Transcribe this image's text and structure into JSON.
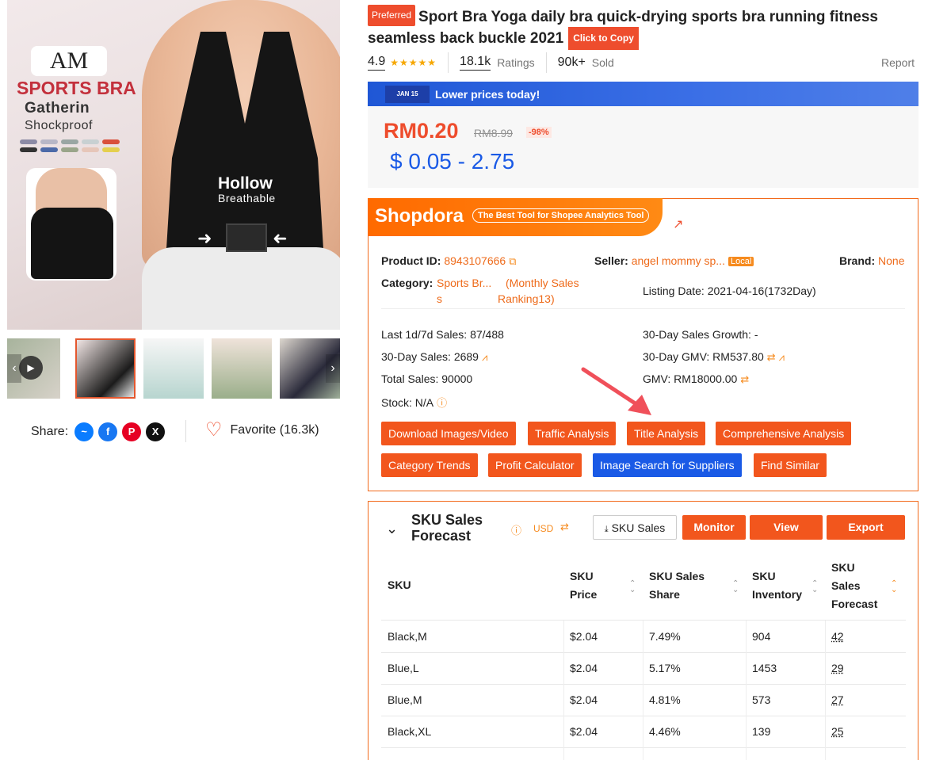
{
  "product": {
    "badge": "Preferred",
    "title": "Sport Bra Yoga daily bra quick-drying sports bra running fitness seamless back buckle 2021",
    "copy_button": "Click to Copy",
    "rating": "4.9",
    "stars": "★★★★★",
    "ratings_count": "18.1k",
    "ratings_label": "Ratings",
    "sold_count": "90k+",
    "sold_label": "Sold",
    "report": "Report"
  },
  "image": {
    "brand": "AM",
    "headline": "SPORTS BRA",
    "line1": "Gatherin",
    "line2": "Shockproof",
    "callout1": "Hollow",
    "callout2": "Breathable",
    "swatch_colors": [
      "#8c8ba5",
      "#b7b7c7",
      "#9aa6a3",
      "#c8d0d2",
      "#d9503c",
      "#333333",
      "#4c6aa8",
      "#9aa58a",
      "#e6c6b9",
      "#e4cf4e"
    ]
  },
  "promo": {
    "tag": "JAN 15",
    "text": "Lower prices today!"
  },
  "price": {
    "current": "RM0.20",
    "original": "RM8.99",
    "discount": "-98%",
    "usd_range": "$ 0.05 - 2.75"
  },
  "share": {
    "label": "Share:",
    "favorite": "Favorite (16.3k)"
  },
  "shopdora": {
    "logo": "Shopdora",
    "tagline": "The Best Tool for Shopee Analytics Tool",
    "product_id_label": "Product ID:",
    "product_id": "8943107666",
    "seller_label": "Seller:",
    "seller": "angel mommy sp...",
    "seller_badge": "Local",
    "brand_label": "Brand:",
    "brand": "None",
    "category_label": "Category:",
    "category_line1": "Sports Br...",
    "category_line2": "s",
    "ranking_line1": "(Monthly Sales",
    "ranking_line2": "Ranking13)",
    "listing_date": "Listing Date: 2021-04-16(1732Day)",
    "sales_1d7d": "Last 1d/7d Sales: 87/488",
    "growth_30d": "30-Day Sales Growth: -",
    "sales_30d": "30-Day Sales: 2689",
    "gmv_30d": "30-Day GMV: RM537.80",
    "total_sales": "Total Sales: 90000",
    "gmv": "GMV: RM18000.00",
    "stock": "Stock: N/A",
    "buttons": [
      "Download Images/Video",
      "Traffic Analysis",
      "Title Analysis",
      "Comprehensive Analysis",
      "Category Trends",
      "Profit Calculator",
      "Image Search for Suppliers",
      "Find Similar"
    ]
  },
  "sku": {
    "title_line1": "SKU Sales",
    "title_line2": "Forecast",
    "currency": "USD",
    "sku_sales_btn": "SKU Sales",
    "monitor": "Monitor",
    "view": "View",
    "export": "Export",
    "headers": {
      "sku": "SKU",
      "price_1": "SKU",
      "price_2": "Price",
      "share_1": "SKU Sales",
      "share_2": "Share",
      "inv_1": "SKU",
      "inv_2": "Inventory",
      "fc_1": "SKU",
      "fc_2": "Sales",
      "fc_3": "Forecast"
    },
    "rows": [
      {
        "sku": "Black,M",
        "price": "$2.04",
        "share": "7.49%",
        "inventory": "904",
        "forecast": "42"
      },
      {
        "sku": "Blue,L",
        "price": "$2.04",
        "share": "5.17%",
        "inventory": "1453",
        "forecast": "29"
      },
      {
        "sku": "Blue,M",
        "price": "$2.04",
        "share": "4.81%",
        "inventory": "573",
        "forecast": "27"
      },
      {
        "sku": "Black,XL",
        "price": "$2.04",
        "share": "4.46%",
        "inventory": "139",
        "forecast": "25"
      }
    ]
  }
}
